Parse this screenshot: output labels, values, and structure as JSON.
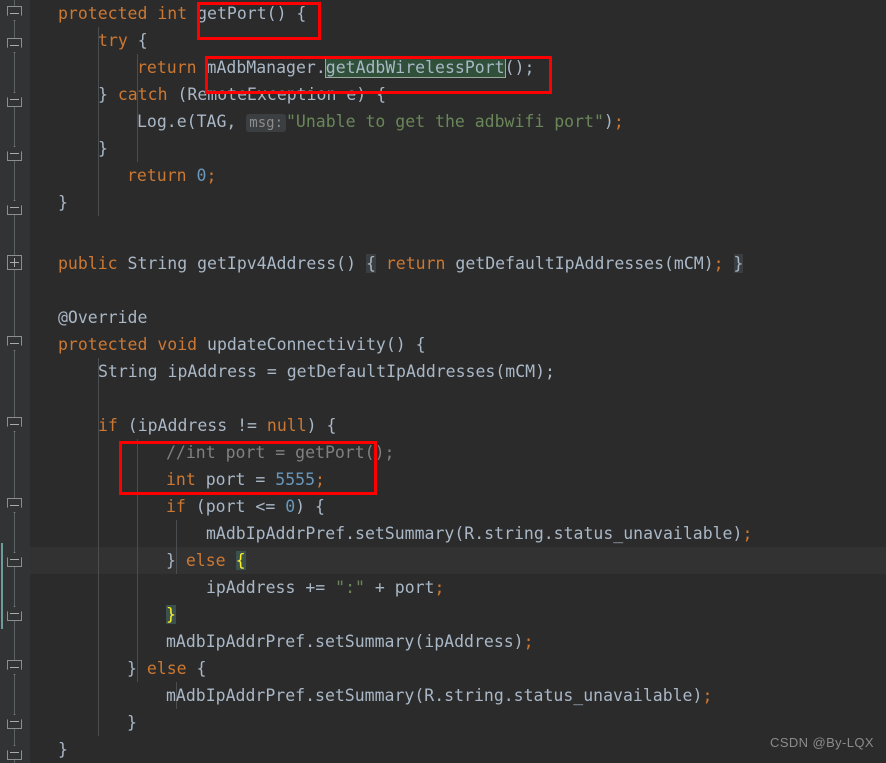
{
  "editor": {
    "theme": "darcula",
    "background": "#2b2b2b",
    "gutter_background": "#313335",
    "default_text_color": "#a9b7c6",
    "keyword_color": "#cc7832",
    "number_color": "#6897bb",
    "string_color": "#6a8759",
    "comment_color": "#808080",
    "annotation_color": "#bbb529",
    "annotation_box_color": "#fe0000",
    "caret_row_color": "#323232",
    "brace_match_color": "#3b514d",
    "usage_highlight_color": "#30503a",
    "match_range_marker_color": "#6d9c9c",
    "language": "Java"
  },
  "code_lines": [
    {
      "indent": 1,
      "text": "protected int getPort() {"
    },
    {
      "indent": 2,
      "text": "try {"
    },
    {
      "indent": 3,
      "text": "return mAdbManager.getAdbWirelessPort();"
    },
    {
      "indent": 2,
      "text": "} catch (RemoteException e) {"
    },
    {
      "indent": 3,
      "text": "Log.e(TAG, msg: \"Unable to get the adbwifi port\");"
    },
    {
      "indent": 2,
      "text": "}"
    },
    {
      "indent": 2,
      "text": "return 0;"
    },
    {
      "indent": 1,
      "text": "}"
    },
    {
      "indent": 0,
      "text": ""
    },
    {
      "indent": 1,
      "text": "public String getIpv4Address() { return getDefaultIpAddresses(mCM); }"
    },
    {
      "indent": 0,
      "text": ""
    },
    {
      "indent": 1,
      "text": "@Override"
    },
    {
      "indent": 1,
      "text": "protected void updateConnectivity() {"
    },
    {
      "indent": 2,
      "text": "String ipAddress = getDefaultIpAddresses(mCM);"
    },
    {
      "indent": 0,
      "text": ""
    },
    {
      "indent": 2,
      "text": "if (ipAddress != null) {"
    },
    {
      "indent": 3,
      "text": "//int port = getPort();"
    },
    {
      "indent": 3,
      "text": "int port = 5555;"
    },
    {
      "indent": 3,
      "text": "if (port <= 0) {"
    },
    {
      "indent": 4,
      "text": "mAdbIpAddrPref.setSummary(R.string.status_unavailable);"
    },
    {
      "indent": 3,
      "text": "} else {"
    },
    {
      "indent": 4,
      "text": "ipAddress += \":\" + port;"
    },
    {
      "indent": 3,
      "text": "}"
    },
    {
      "indent": 3,
      "text": "mAdbIpAddrPref.setSummary(ipAddress);"
    },
    {
      "indent": 2,
      "text": "} else {"
    },
    {
      "indent": 3,
      "text": "mAdbIpAddrPref.setSummary(R.string.status_unavailable);"
    },
    {
      "indent": 2,
      "text": "}"
    },
    {
      "indent": 1,
      "text": "}"
    }
  ],
  "tokens": {
    "kw_protected": "protected",
    "kw_int": "int",
    "kw_public": "public",
    "kw_void": "void",
    "kw_return": "return",
    "kw_try": "try",
    "kw_catch": "catch",
    "kw_if": "if",
    "kw_else": "else",
    "kw_null": "null",
    "type_String": "String",
    "method_getPort": "getPort() {",
    "expr_mAdbManager": "mAdbManager.",
    "usage_getAdbWirelessPort": "getAdbWirelessPort",
    "call_close": "();",
    "catch_head": "} catch (RemoteException e) {",
    "log_call": "Log.e(TAG, ",
    "log_hint": "msg:",
    "log_string": "\"Unable to get the adbwifi port\"",
    "log_tail": ");",
    "brace_close": "}",
    "return_zero_kw": "return",
    "return_zero_val": "0",
    "semicolon": ";",
    "ipv4_sig_a": "public String getIpv4Address() ",
    "ipv4_brace_open": "{",
    "ipv4_return": " return",
    "ipv4_body": " getDefaultIpAddresses(mCM);",
    "ipv4_brace_close": "}",
    "override": "@Override",
    "update_sig": "protected void updateConnectivity() {",
    "ipaddr_decl": "String ipAddress = getDefaultIpAddresses(mCM);",
    "if_ipaddress": "if (ipAddress != null) {",
    "comment_port": "//int port = getPort();",
    "int_port_kw": "int",
    "int_port_rest": " port = ",
    "int_port_val": "5555",
    "if_port": "if (port <= 0) {",
    "set_unavailable": "mAdbIpAddrPref.setSummary(R.string.status_unavailable);",
    "else_open_head": "} ",
    "else_open_kw": "else",
    "else_open_brace": "{",
    "ipaddress_concat_a": "ipAddress += ",
    "ipaddress_concat_str": "\":\"",
    "ipaddress_concat_b": " + port",
    "set_ipaddress": "mAdbIpAddrPref.setSummary(ipAddress);",
    "else_tail": "} else {"
  },
  "annotations": {
    "boxes": [
      {
        "name": "getport-signature-box",
        "label": "getPort() {"
      },
      {
        "name": "getadbwirelessport-call-box",
        "label": "mAdbManager.getAdbWirelessPort();"
      },
      {
        "name": "port-assignment-box",
        "label": "//int port = getPort();  int port = 5555;"
      }
    ]
  },
  "gutter": {
    "fold_markers": [
      {
        "type": "down",
        "line": 1
      },
      {
        "type": "down",
        "line": 2
      },
      {
        "type": "up",
        "line": 4
      },
      {
        "type": "up",
        "line": 6
      },
      {
        "type": "up",
        "line": 8
      },
      {
        "type": "plus",
        "line": 10
      },
      {
        "type": "down",
        "line": 13
      },
      {
        "type": "down",
        "line": 16
      },
      {
        "type": "down",
        "line": 19
      },
      {
        "type": "up",
        "line": 21
      },
      {
        "type": "up",
        "line": 23
      },
      {
        "type": "down",
        "line": 25
      },
      {
        "type": "up",
        "line": 27
      },
      {
        "type": "up",
        "line": 28
      }
    ]
  },
  "watermark": {
    "text": "CSDN @By-LQX"
  }
}
